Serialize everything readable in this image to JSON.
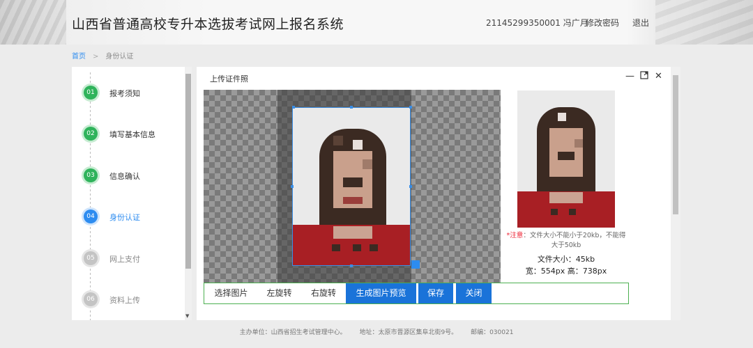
{
  "header": {
    "title": "山西省普通高校专升本选拔考试网上报名系统",
    "user_id": "21145299350001  冯广月",
    "change_password": "修改密码",
    "logout": "退出"
  },
  "breadcrumb": {
    "home": "首页",
    "separator": ">",
    "current": "身份认证"
  },
  "steps": [
    {
      "num": "01",
      "label": "报考须知",
      "status": "done"
    },
    {
      "num": "02",
      "label": "填写基本信息",
      "status": "done"
    },
    {
      "num": "03",
      "label": "信息确认",
      "status": "done"
    },
    {
      "num": "04",
      "label": "身份认证",
      "status": "active"
    },
    {
      "num": "05",
      "label": "网上支付",
      "status": "todo"
    },
    {
      "num": "06",
      "label": "资料上传",
      "status": "todo"
    }
  ],
  "dialog": {
    "title": "上传证件照",
    "minimize_icon": "minimize-icon",
    "maximize_icon": "maximize-icon",
    "close_icon": "close-icon",
    "notice_label": "*注意",
    "notice_text": "：文件大小不能小于20kb，不能得大于50kb",
    "file_size": "文件大小：45kb",
    "file_dim": "宽：554px 高：738px"
  },
  "toolbar": {
    "select_image": "选择图片",
    "rotate_left": "左旋转",
    "rotate_right": "右旋转",
    "generate_preview": "生成图片预览",
    "save": "保存",
    "close": "关闭"
  },
  "footer": {
    "organizer": "主办单位：山西省招生考试管理中心。",
    "address": "地址：太原市晋源区集阜北街9号。",
    "postcode": "邮编：030021"
  },
  "colors": {
    "accent": "#2d8cf0",
    "done": "#2fb35b",
    "button_blue": "#1a73d9",
    "toolbar_border": "#4caf50",
    "notice_red": "#e23"
  }
}
